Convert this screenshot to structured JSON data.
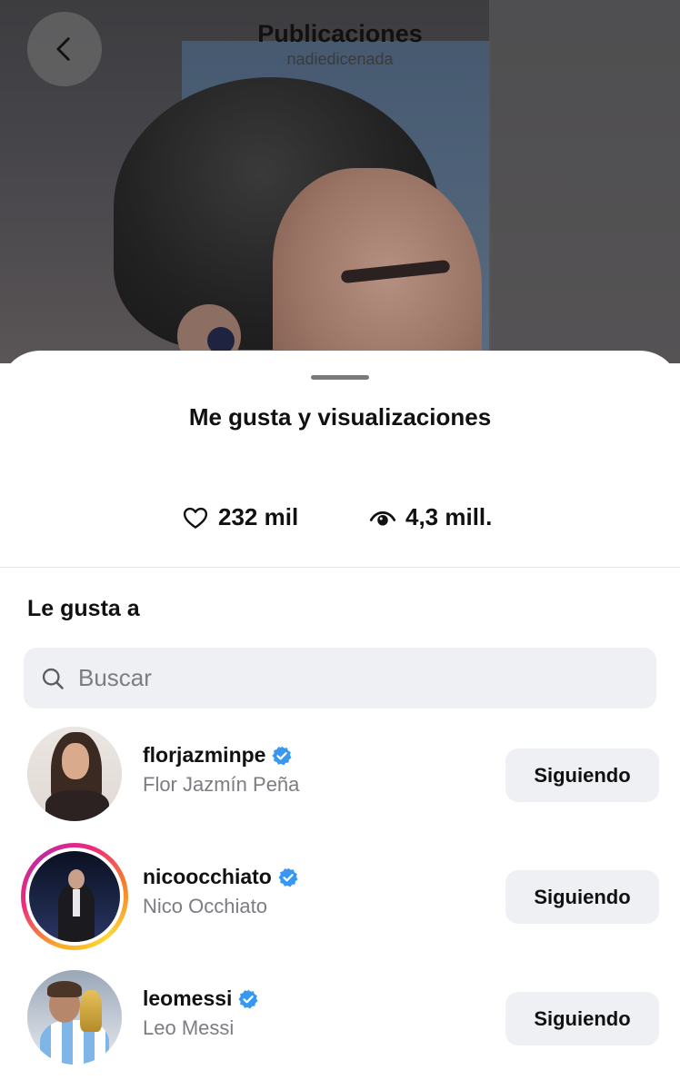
{
  "header": {
    "title": "Publicaciones",
    "subtitle": "nadiedicenada",
    "back_icon": "chevron-left-icon"
  },
  "sheet": {
    "title": "Me gusta y visualizaciones",
    "stats": {
      "likes": {
        "icon": "heart-icon",
        "value": "232 mil"
      },
      "views": {
        "icon": "eye-icon",
        "value": "4,3 mill."
      }
    },
    "section_title": "Le gusta a",
    "search": {
      "placeholder": "Buscar",
      "value": ""
    },
    "users": [
      {
        "username": "florjazminpe",
        "full_name": "Flor Jazmín Peña",
        "verified": true,
        "has_story_ring": false,
        "button_label": "Siguiendo"
      },
      {
        "username": "nicoocchiato",
        "full_name": "Nico Occhiato",
        "verified": true,
        "has_story_ring": true,
        "button_label": "Siguiendo"
      },
      {
        "username": "leomessi",
        "full_name": "Leo Messi",
        "verified": true,
        "has_story_ring": false,
        "button_label": "Siguiendo"
      }
    ]
  },
  "colors": {
    "verified_badge": "#3897f0",
    "button_bg": "#eff0f3",
    "secondary_text": "#7c7c82"
  }
}
